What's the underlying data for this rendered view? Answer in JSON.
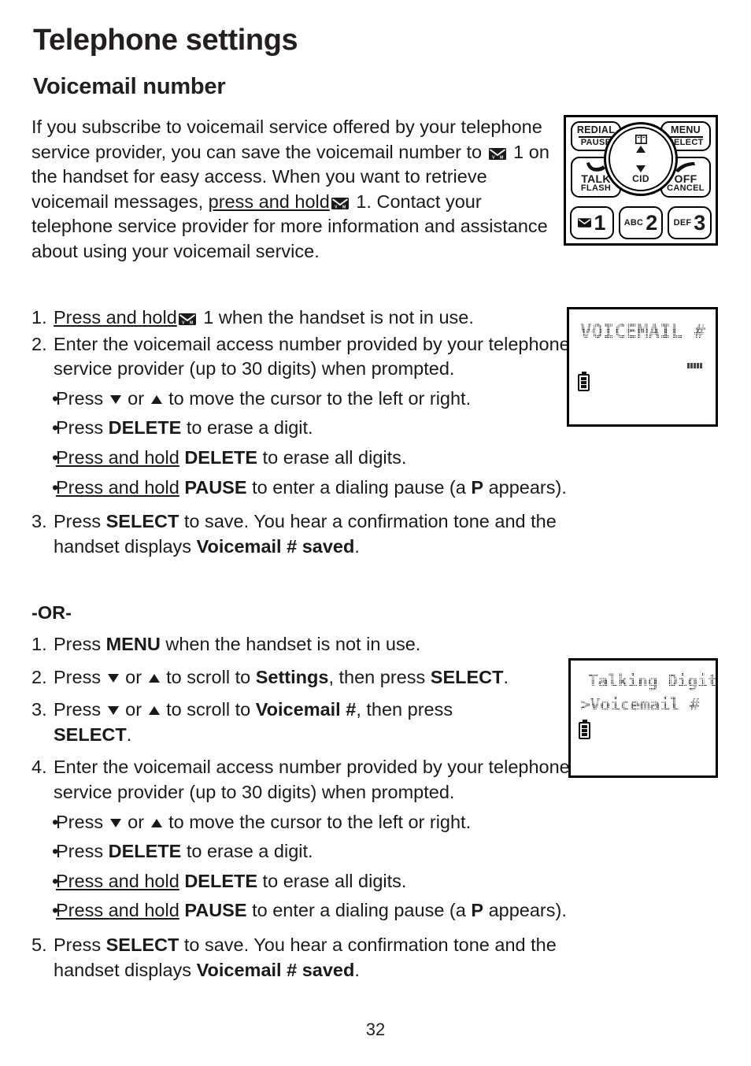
{
  "document": {
    "chapter_title": "Telephone settings",
    "section_title": "Voicemail number",
    "page_number": "32"
  },
  "intro": {
    "part1": "If you subscribe to voicemail service offered by your telephone service provider, you can save the voicemail number to ",
    "part2": " 1 on the handset for easy access. When you want to retrieve voicemail messages, ",
    "press_and_hold": "press and hold",
    "part3": " 1. Contact your telephone service provider for more information and assistance about using your voicemail service."
  },
  "list_one": {
    "items": [
      {
        "number": "1.",
        "press_and_hold": "Press and hold",
        "after_icon": " 1 when the handset is not in use."
      },
      {
        "number": "2.",
        "text": "Enter the voicemail access number provided by your telephone service provider (up to 30 digits) when prompted."
      },
      {
        "number": "3.",
        "pre": "Press ",
        "key": "SELECT",
        "mid": " to save. You hear a confirmation tone and the handset displays ",
        "bold_end": "Voicemail # saved",
        "post": "."
      }
    ],
    "bullets": [
      {
        "marker": "•",
        "pre": "Press ",
        "post": " to move the cursor to the left or right."
      },
      {
        "marker": "•",
        "pre": "Press ",
        "key": "DELETE",
        "post": " to erase a digit."
      },
      {
        "marker": "•",
        "underlined": "Press and hold",
        "key": "DELETE",
        "post": " to erase all digits."
      },
      {
        "marker": "•",
        "underlined": "Press and hold",
        "key": "PAUSE",
        "mid": " to enter a dialing pause (a ",
        "bold": "P",
        "post": " appears)."
      }
    ]
  },
  "or_divider": "-OR-",
  "list_two": {
    "items": [
      {
        "number": "1.",
        "pre": "Press ",
        "key": "MENU",
        "post": " when the handset is not in use."
      },
      {
        "number": "2.",
        "pre": "Press ",
        "mid": " to scroll to ",
        "key": "Settings",
        "mid2": ", then press ",
        "key2": "SELECT",
        "post": "."
      },
      {
        "number": "3.",
        "pre": "Press ",
        "mid": " to scroll to ",
        "key": "Voicemail #",
        "mid2": ", then press ",
        "key2": "SELECT",
        "post": "."
      },
      {
        "number": "4.",
        "text": "Enter the voicemail access number provided by your telephone service provider (up to 30 digits) when prompted."
      },
      {
        "number": "5.",
        "pre": "Press ",
        "key": "SELECT",
        "mid": " to save. You hear a confirmation tone and the handset displays ",
        "bold_end": "Voicemail # saved",
        "post": "."
      }
    ],
    "bullets": [
      {
        "marker": "•",
        "pre": "Press ",
        "post": " to move the cursor to the left or right."
      },
      {
        "marker": "•",
        "pre": "Press ",
        "key": "DELETE",
        "post": " to erase a digit."
      },
      {
        "marker": "•",
        "underlined": "Press and hold",
        "key": "DELETE",
        "post": " to erase all digits."
      },
      {
        "marker": "•",
        "underlined": "Press and hold",
        "key": "PAUSE",
        "mid": " to enter a dialing pause (a ",
        "bold": "P",
        "post": " appears)."
      }
    ]
  },
  "keypad": {
    "redial": {
      "line1": "REDIAL",
      "line2": "PAUSE"
    },
    "menu": {
      "line1": "MENU",
      "line2": "SELECT"
    },
    "talk": {
      "line1": "TALK",
      "line2": "FLASH"
    },
    "off": {
      "line1": "OFF",
      "line2": "CANCEL"
    },
    "navigation": {
      "cid_label": "CID"
    },
    "number_keys": [
      {
        "sub": "",
        "digit": "1",
        "icon": "envelope-icon"
      },
      {
        "sub": "ABC",
        "digit": "2"
      },
      {
        "sub": "DEF",
        "digit": "3"
      }
    ]
  },
  "lcd_one": {
    "line1": "VOICEMAIL #"
  },
  "lcd_two": {
    "line1": "Talking Digit",
    "line2": "Voicemail #"
  },
  "colors": {
    "ink": "#231f20",
    "paper": "#ffffff"
  }
}
